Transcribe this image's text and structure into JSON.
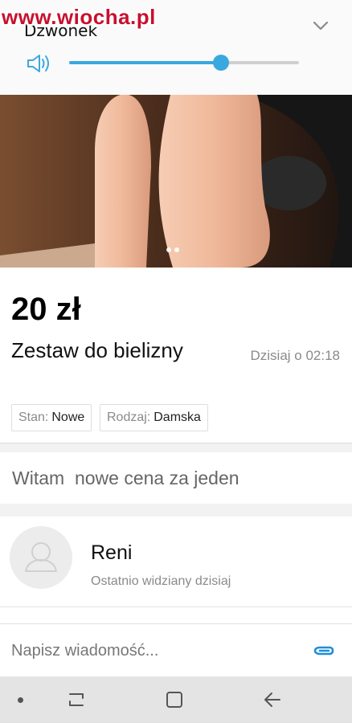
{
  "watermark": "www.wiocha.pl",
  "volume": {
    "title": "Dzwonek",
    "level": 0.66,
    "accent_color": "#3aa8e0",
    "icons": [
      "speaker-icon",
      "chevron-down-icon"
    ]
  },
  "listing": {
    "price": "20 zł",
    "title": "Zestaw do bielizny",
    "date": "Dzisiaj o 02:18",
    "photo_pages": 2,
    "tags": [
      {
        "label": "Stan:",
        "value": "Nowe"
      },
      {
        "label": "Rodzaj:",
        "value": "Damska"
      }
    ]
  },
  "message": {
    "text": "Witam  nowe cena za jeden"
  },
  "seller": {
    "name": "Reni",
    "last_seen": "Ostatnio widziany dzisiaj"
  },
  "compose": {
    "placeholder": "Napisz wiadomość...",
    "icon": "paperclip-icon"
  },
  "navbar": {
    "icons": [
      "nav-dot-icon",
      "recents-icon",
      "home-icon",
      "back-icon"
    ]
  }
}
